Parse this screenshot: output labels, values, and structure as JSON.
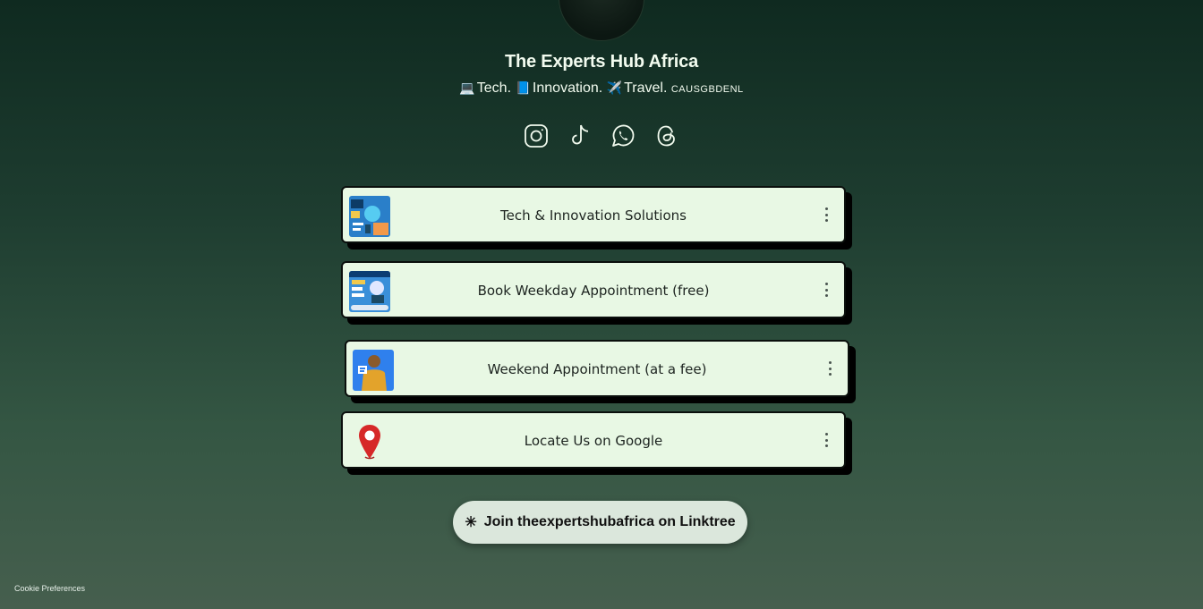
{
  "profile": {
    "title": "The Experts Hub Africa",
    "bio": {
      "emoji1": "💻",
      "part1": "Tech.",
      "emoji2": "📘",
      "part2": "Innovation.",
      "emoji3": "✈️",
      "part3": "Travel.",
      "countries": "CAUSGBDENL"
    }
  },
  "socials": [
    {
      "name": "instagram-icon"
    },
    {
      "name": "tiktok-icon"
    },
    {
      "name": "whatsapp-icon"
    },
    {
      "name": "threads-icon"
    }
  ],
  "links": [
    {
      "label": "Tech & Innovation Solutions",
      "thumb": "tech-thumbnail"
    },
    {
      "label": "Book Weekday Appointment (free)",
      "thumb": "weekday-thumbnail"
    },
    {
      "label": "Weekend Appointment (at a fee)",
      "thumb": "weekend-thumbnail"
    },
    {
      "label": "Locate Us on Google",
      "thumb": "map-pin-icon"
    }
  ],
  "footer": {
    "join_star": "✳",
    "join_label": "Join theexpertshubafrica on Linktree",
    "cookie_label": "Cookie Preferences"
  },
  "colors": {
    "card_bg": "#e8f8e4",
    "card_border": "#0a0f0c",
    "text_light": "#f2fbef",
    "join_bg": "#dbe7dc"
  }
}
